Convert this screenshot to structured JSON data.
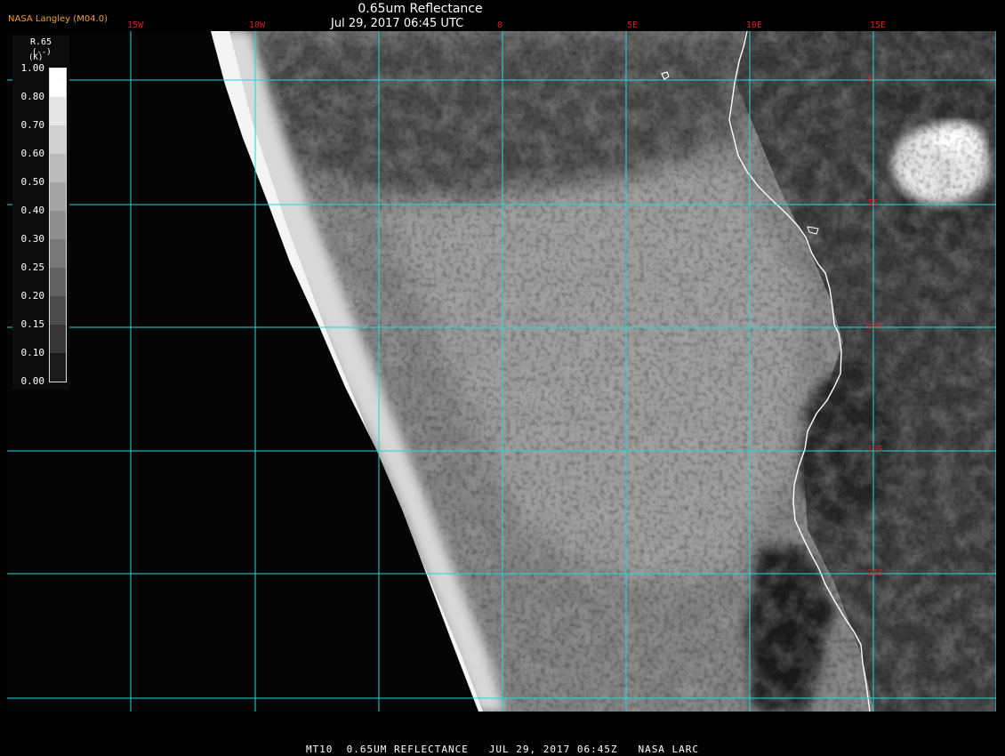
{
  "header": {
    "title": "0.65um Reflectance",
    "timestamp": "Jul 29, 2017 06:45 UTC",
    "provider": "NASA Langley (M04.0)"
  },
  "longitude_labels": [
    "15W",
    "10W",
    "0",
    "5E",
    "10E",
    "15E"
  ],
  "latitude_labels": [
    "0",
    "5S",
    "10S",
    "15S",
    "20S"
  ],
  "legend": {
    "title": "R.65",
    "units": "(--)",
    "unit_letter": "(K)",
    "ticks": [
      "1.00",
      "0.80",
      "0.70",
      "0.60",
      "0.50",
      "0.40",
      "0.30",
      "0.25",
      "0.20",
      "0.15",
      "0.10",
      "0.00"
    ]
  },
  "footer": "MT10  0.65UM REFLECTANCE   JUL 29, 2017 06:45Z   NASA LARC",
  "colors": {
    "grid": "#27d6d6",
    "coast": "#ffffff",
    "label_red": "#d02020",
    "provider": "#f0a030"
  }
}
